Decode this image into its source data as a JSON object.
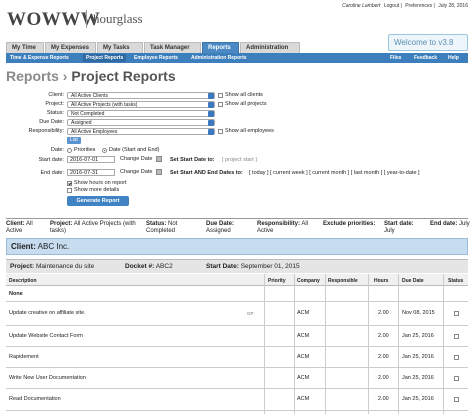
{
  "header": {
    "logo_text": "WOWWW",
    "brand_text": "hourglass",
    "user_name": "Caroline Lambert",
    "logout": "Logout",
    "preferences": "Preferences",
    "date": "July 28, 2016",
    "welcome": "Welcome to v3.8"
  },
  "tabs": [
    "My Time",
    "My Expenses",
    "My Tasks",
    "Task Manager",
    "Reports",
    "Administration"
  ],
  "subnav": {
    "items": [
      "Time & Expense Reports",
      "Project Reports",
      "Employee Reports",
      "Administration Reports"
    ],
    "right": [
      "Files",
      "Feedback",
      "Help"
    ]
  },
  "breadcrumb": {
    "parent": "Reports",
    "separator": "›",
    "current": "Project Reports"
  },
  "form": {
    "client_label": "Client:",
    "client_value": "All Active Clients",
    "show_all_clients": "Show all clients",
    "project_label": "Project:",
    "project_value": "All Active Projects (with tasks)",
    "show_all_projects": "Show all projects",
    "status_label": "Status:",
    "status_value": "Not Completed",
    "due_date_label": "Due Date:",
    "due_date_value": "Assigned",
    "responsibility_label": "Responsibility:",
    "responsibility_value": "All Active Employees",
    "show_all_employees": "Show all employees",
    "list_button": "List",
    "date_label": "Date:",
    "priorities_option": "Priorities",
    "date_option": "Date (Start and End)",
    "start_date_label": "Start date:",
    "start_date_value": "2016-07-01",
    "end_date_label": "End date:",
    "end_date_value": "2016-07-31",
    "change_date": "Change Date",
    "set_start_to": "Set Start Date to:",
    "set_start_options": "[ project start ]",
    "set_both_to": "Set Start AND End Dates to:",
    "set_both_options": "[ today ] [ current week ] [ current month ] [ last month ] [ year-to-date ]",
    "show_hours": "Show hours on report",
    "show_more": "Show more details",
    "generate": "Generate Report"
  },
  "summary": {
    "client_k": "Client:",
    "client_v": "All Active",
    "project_k": "Project:",
    "project_v": "All Active Projects (with tasks)",
    "status_k": "Status:",
    "status_v": "Not Completed",
    "due_k": "Due Date:",
    "due_v": "Assigned",
    "resp_k": "Responsibility:",
    "resp_v": "All Active",
    "excl_k": "Exclude priorities:",
    "start_k": "Start date:",
    "start_v": "July",
    "end_k": "End date:",
    "end_v": "July"
  },
  "client_bar": {
    "label": "Client:",
    "name": "ABC Inc."
  },
  "project_bar": {
    "project_label": "Project:",
    "project_name": "Maintenance du site",
    "docket_label": "Docket #:",
    "docket_value": "ABC2",
    "start_label": "Start Date:",
    "start_value": "September 01, 2015"
  },
  "table": {
    "headers": [
      "Description",
      "Priority",
      "Company",
      "Responsible",
      "Hours",
      "Due Date",
      "Status"
    ],
    "rows": [
      {
        "description": "None",
        "priority": "",
        "company": "",
        "responsible": "",
        "hours": "",
        "due": "",
        "bold": true
      },
      {
        "description": "Update creative on affiliate site.",
        "gp": "GP",
        "priority": "",
        "company": "ACM",
        "responsible": "",
        "hours": "2.00",
        "due": "Nov 08, 2015"
      },
      {
        "description": "Update Website Contact Form",
        "priority": "",
        "company": "ACM",
        "responsible": "",
        "hours": "2.00",
        "due": "Jan 25, 2016"
      },
      {
        "description": "Rapidement",
        "priority": "",
        "company": "ACM",
        "responsible": "",
        "hours": "2.00",
        "due": "Jan 25, 2016"
      },
      {
        "description": "Write New User Documentation",
        "priority": "",
        "company": "ACM",
        "responsible": "",
        "hours": "2.00",
        "due": "Jan 25, 2016"
      },
      {
        "description": "Read Documentation",
        "priority": "",
        "company": "ACM",
        "responsible": "",
        "hours": "2.00",
        "due": "Jan 25, 2016"
      }
    ]
  }
}
